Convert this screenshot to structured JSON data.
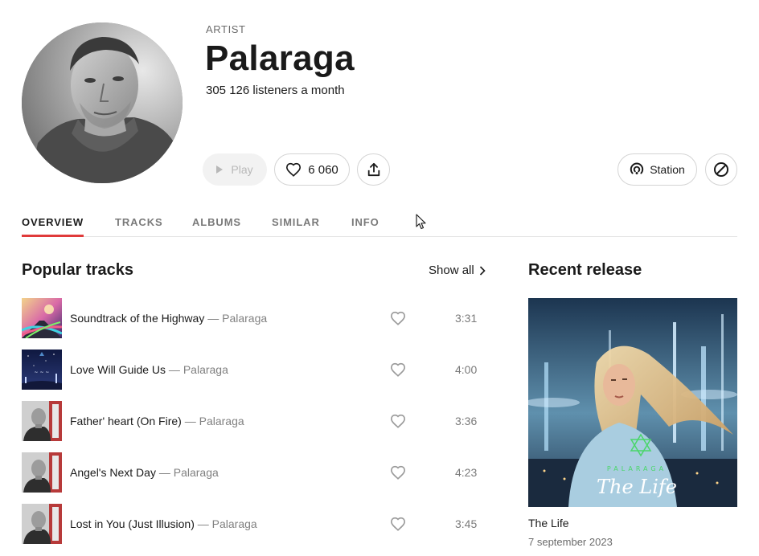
{
  "artist": {
    "kind": "ARTIST",
    "name": "Palaraga",
    "listeners": "305 126 listeners a month"
  },
  "actions": {
    "play_label": "Play",
    "likes_count": "6 060",
    "station_label": "Station"
  },
  "tabs": [
    {
      "label": "OVERVIEW",
      "active": true
    },
    {
      "label": "TRACKS",
      "active": false
    },
    {
      "label": "ALBUMS",
      "active": false
    },
    {
      "label": "SIMILAR",
      "active": false
    },
    {
      "label": "INFO",
      "active": false
    }
  ],
  "popular": {
    "title": "Popular tracks",
    "show_all": "Show all",
    "tracks": [
      {
        "name": "Soundtrack of the Highway",
        "sep": " — ",
        "artist": "Palaraga",
        "duration": "3:31"
      },
      {
        "name": "Love Will Guide Us",
        "sep": " — ",
        "artist": "Palaraga",
        "duration": "4:00"
      },
      {
        "name": "Father' heart (On Fire)",
        "sep": " — ",
        "artist": "Palaraga",
        "duration": "3:36"
      },
      {
        "name": "Angel's Next Day",
        "sep": " — ",
        "artist": "Palaraga",
        "duration": "4:23"
      },
      {
        "name": "Lost in You (Just Illusion)",
        "sep": " — ",
        "artist": "Palaraga",
        "duration": "3:45"
      }
    ]
  },
  "release": {
    "section_title": "Recent release",
    "name": "The Life",
    "date": "7 september 2023",
    "cover_brand": "PALARAGA",
    "cover_title": "The Life"
  },
  "colors": {
    "accent_underline": "#e03a3a",
    "muted_text": "#808080",
    "border": "#d4d4d4"
  },
  "icons": [
    "play-icon",
    "heart-icon",
    "share-icon",
    "station-icon",
    "block-icon",
    "chevron-right-icon",
    "mouse-cursor-icon"
  ]
}
